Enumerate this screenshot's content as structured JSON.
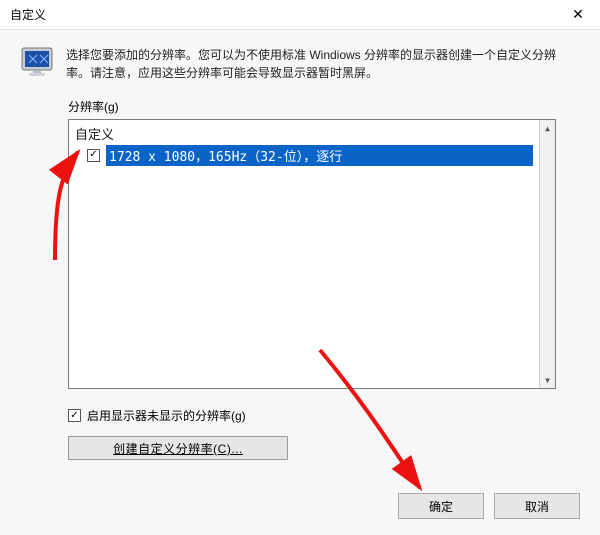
{
  "window": {
    "title": "自定义"
  },
  "intro": {
    "text": "选择您要添加的分辨率。您可以为不使用标准 Windiows 分辨率的显示器创建一个自定义分辨率。请注意，应用这些分辨率可能会导致显示器暂时黑屏。"
  },
  "field": {
    "label": "分辨率(g)"
  },
  "list": {
    "header": "自定义",
    "items": [
      {
        "checked": true,
        "text": "1728 x 1080，165Hz（32-位），逐行",
        "selected": true
      }
    ]
  },
  "enable_unshown": {
    "checked": true,
    "label": "启用显示器未显示的分辨率(g)"
  },
  "create_button": {
    "label": "创建自定义分辨率(C)..."
  },
  "footer": {
    "ok": "确定",
    "cancel": "取消"
  },
  "icons": {
    "close": "✕",
    "check": "✓",
    "arrow_up": "▲",
    "arrow_down": "▼",
    "delete_x": "✕"
  }
}
